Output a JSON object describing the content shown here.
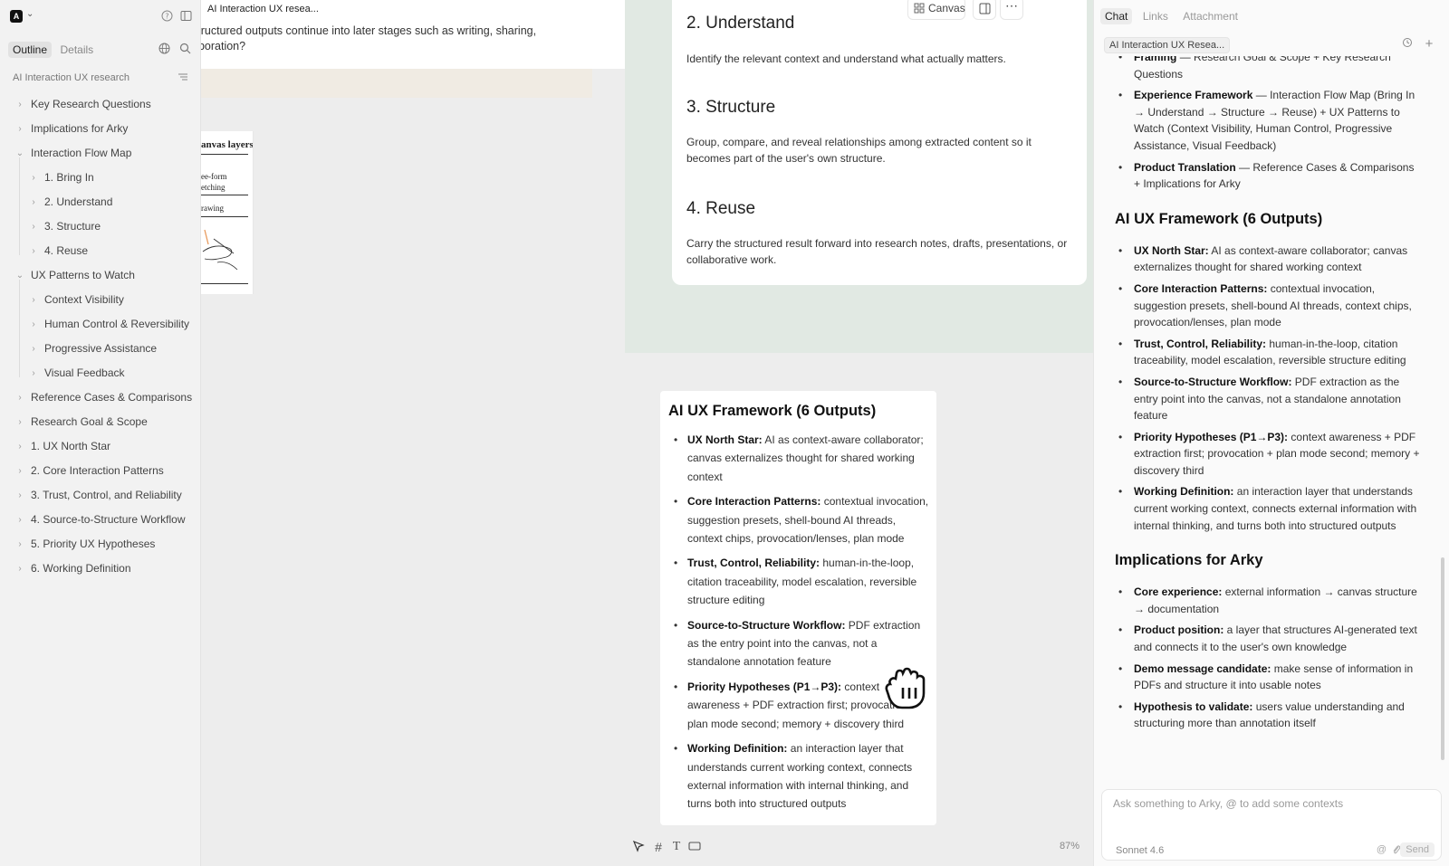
{
  "sidebar": {
    "tabs": [
      {
        "label": "Outline",
        "active": true
      },
      {
        "label": "Details",
        "active": false
      }
    ],
    "doc_title": "AI Interaction UX research",
    "outline": [
      {
        "label": "Key Research Questions",
        "level": 0,
        "expanded": false
      },
      {
        "label": "Implications for Arky",
        "level": 0,
        "expanded": false
      },
      {
        "label": "Interaction Flow Map",
        "level": 0,
        "expanded": true
      },
      {
        "label": "1. Bring In",
        "level": 1,
        "expanded": false
      },
      {
        "label": "2. Understand",
        "level": 1,
        "expanded": false
      },
      {
        "label": "3. Structure",
        "level": 1,
        "expanded": false
      },
      {
        "label": "4. Reuse",
        "level": 1,
        "expanded": false
      },
      {
        "label": "UX Patterns to Watch",
        "level": 0,
        "expanded": true
      },
      {
        "label": "Context Visibility",
        "level": 1,
        "expanded": false
      },
      {
        "label": "Human Control & Reversibility",
        "level": 1,
        "expanded": false
      },
      {
        "label": "Progressive Assistance",
        "level": 1,
        "expanded": false
      },
      {
        "label": "Visual Feedback",
        "level": 1,
        "expanded": false
      },
      {
        "label": "Reference Cases & Comparisons",
        "level": 0,
        "expanded": false
      },
      {
        "label": "Research Goal & Scope",
        "level": 0,
        "expanded": false
      },
      {
        "label": "1. UX North Star",
        "level": 0,
        "expanded": false
      },
      {
        "label": "2. Core Interaction Patterns",
        "level": 0,
        "expanded": false
      },
      {
        "label": "3. Trust, Control, and Reliability",
        "level": 0,
        "expanded": false
      },
      {
        "label": "4. Source-to-Structure Workflow",
        "level": 0,
        "expanded": false
      },
      {
        "label": "5. Priority UX Hypotheses",
        "level": 0,
        "expanded": false
      },
      {
        "label": "6. Working Definition",
        "level": 0,
        "expanded": false
      }
    ]
  },
  "canvas": {
    "beige_card": {
      "tag": "AI Interaction UX resea...",
      "text_line1": "structured outputs continue into later stages such as writing, sharing,",
      "text_line2": "aboration?"
    },
    "sketch_card": {
      "title": "anvas layers.",
      "row1a": "ee-form",
      "row1b": "etching",
      "row2": "rawing"
    },
    "toolbar": {
      "canvas_label": "Canvas"
    },
    "steps": [
      {
        "title": "2. Understand",
        "desc": "Identify the relevant context and understand what actually matters."
      },
      {
        "title": "3. Structure",
        "desc": "Group, compare, and reveal relationships among extracted content so it becomes part of the user's own structure."
      },
      {
        "title": "4. Reuse",
        "desc": "Carry the structured result forward into research notes, drafts, presentations, or collaborative work."
      }
    ],
    "framework_card": {
      "title": "AI UX Framework (6 Outputs)",
      "items": [
        {
          "label": "UX North Star:",
          "text": "AI as context-aware collaborator; canvas externalizes thought for shared working context"
        },
        {
          "label": "Core Interaction Patterns:",
          "text": "contextual invocation, suggestion presets, shell-bound AI threads, context chips, provocation/lenses, plan mode"
        },
        {
          "label": "Trust, Control, Reliability:",
          "text": "human-in-the-loop, citation traceability, model escalation, reversible structure editing"
        },
        {
          "label": "Source-to-Structure Workflow:",
          "text": "PDF extraction as the entry point into the canvas, not a standalone annotation feature"
        },
        {
          "label": "Priority Hypotheses (P1→P3):",
          "text": "context awareness + PDF extraction first; provocation + plan mode second; memory + discovery third"
        },
        {
          "label": "Working Definition:",
          "text": "an interaction layer that understands current working context, connects external information with internal thinking, and turns both into structured outputs"
        }
      ]
    },
    "zoom": "87%"
  },
  "chat": {
    "tabs": [
      {
        "label": "Chat",
        "active": true
      },
      {
        "label": "Links",
        "active": false
      },
      {
        "label": "Attachment",
        "active": false
      }
    ],
    "doc_chip": "AI Interaction UX Resea...",
    "top_list": [
      {
        "label": "Framing",
        "text": "— Research Goal & Scope + Key Research Questions"
      },
      {
        "label": "Experience Framework",
        "text": "— Interaction Flow Map (Bring In → Understand → Structure → Reuse) + UX Patterns to Watch (Context Visibility, Human Control, Progressive Assistance, Visual Feedback)"
      },
      {
        "label": "Product Translation",
        "text": "— Reference Cases & Comparisons + Implications for Arky"
      }
    ],
    "framework_heading": "AI UX Framework (6 Outputs)",
    "framework_list": [
      {
        "label": "UX North Star:",
        "text": "AI as context-aware collaborator; canvas externalizes thought for shared working context"
      },
      {
        "label": "Core Interaction Patterns:",
        "text": "contextual invocation, suggestion presets, shell-bound AI threads, context chips, provocation/lenses, plan mode"
      },
      {
        "label": "Trust, Control, Reliability:",
        "text": "human-in-the-loop, citation traceability, model escalation, reversible structure editing"
      },
      {
        "label": "Source-to-Structure Workflow:",
        "text": "PDF extraction as the entry point into the canvas, not a standalone annotation feature"
      },
      {
        "label": "Priority Hypotheses (P1→P3):",
        "text": "context awareness + PDF extraction first; provocation + plan mode second; memory + discovery third"
      },
      {
        "label": "Working Definition:",
        "text": "an interaction layer that understands current working context, connects external information with internal thinking, and turns both into structured outputs"
      }
    ],
    "implications_heading": "Implications for Arky",
    "implications_list": [
      {
        "label": "Core experience:",
        "text": "external information → canvas structure → documentation"
      },
      {
        "label": "Product position:",
        "text": "a layer that structures AI-generated text and connects it to the user's own knowledge"
      },
      {
        "label": "Demo message candidate:",
        "text": "make sense of information in PDFs and structure it into usable notes"
      },
      {
        "label": "Hypothesis to validate:",
        "text": "users value understanding and structuring more than annotation itself"
      }
    ],
    "input": {
      "placeholder": "Ask something to Arky, @ to add some contexts",
      "model": "Sonnet 4.6",
      "send_label": "Send"
    }
  }
}
